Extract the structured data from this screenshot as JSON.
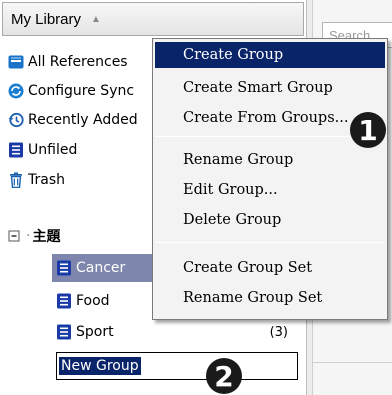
{
  "library": {
    "header_title": "My Library",
    "items": [
      {
        "label": "All References",
        "icon": "library-icon"
      },
      {
        "label": "Configure Sync",
        "icon": "sync-icon"
      },
      {
        "label": "Recently Added",
        "icon": "history-icon"
      },
      {
        "label": "Unfiled",
        "icon": "list-icon"
      },
      {
        "label": "Trash",
        "icon": "trash-icon"
      }
    ],
    "group_set": {
      "label": "主題",
      "expanded": true
    },
    "groups": [
      {
        "label": "Cancer",
        "count": "",
        "selected": true
      },
      {
        "label": "Food",
        "count": ""
      },
      {
        "label": "Sport",
        "count": "(3)"
      }
    ],
    "new_group_value": "New Group"
  },
  "search": {
    "placeholder": "Search"
  },
  "context_menu": {
    "items": [
      {
        "label": "Create Group",
        "active": true
      },
      {
        "label": "Create Smart Group"
      },
      {
        "label": "Create From Groups..."
      },
      {
        "label": "Rename Group"
      },
      {
        "label": "Edit Group..."
      },
      {
        "label": "Delete Group"
      },
      {
        "label": "Create Group Set"
      },
      {
        "label": "Rename Group Set"
      }
    ]
  },
  "callouts": [
    "1",
    "2"
  ],
  "colors": {
    "selection": "#0a246a",
    "selected_row": "#7f86ad",
    "library_icon": "#1a73c8",
    "group_icon": "#1a3aa8",
    "sync_icon": "#1a7fd0"
  }
}
